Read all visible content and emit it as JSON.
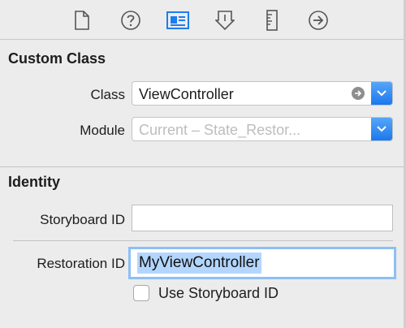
{
  "toolbar": {
    "icons": [
      "file-inspector-icon",
      "quick-help-icon",
      "identity-inspector-icon",
      "attributes-inspector-icon",
      "size-inspector-icon",
      "connections-inspector-icon"
    ],
    "selected_icon": "identity-inspector-icon",
    "accent_color": "#1e7cf0"
  },
  "custom_class": {
    "title": "Custom Class",
    "class_label": "Class",
    "class_value": "ViewController",
    "module_label": "Module",
    "module_placeholder": "Current – State_Restor..."
  },
  "identity": {
    "title": "Identity",
    "storyboard_id_label": "Storyboard ID",
    "storyboard_id_value": "",
    "restoration_id_label": "Restoration ID",
    "restoration_id_value": "MyViewController",
    "use_storyboard_id_label": "Use Storyboard ID",
    "use_storyboard_id_checked": false
  }
}
